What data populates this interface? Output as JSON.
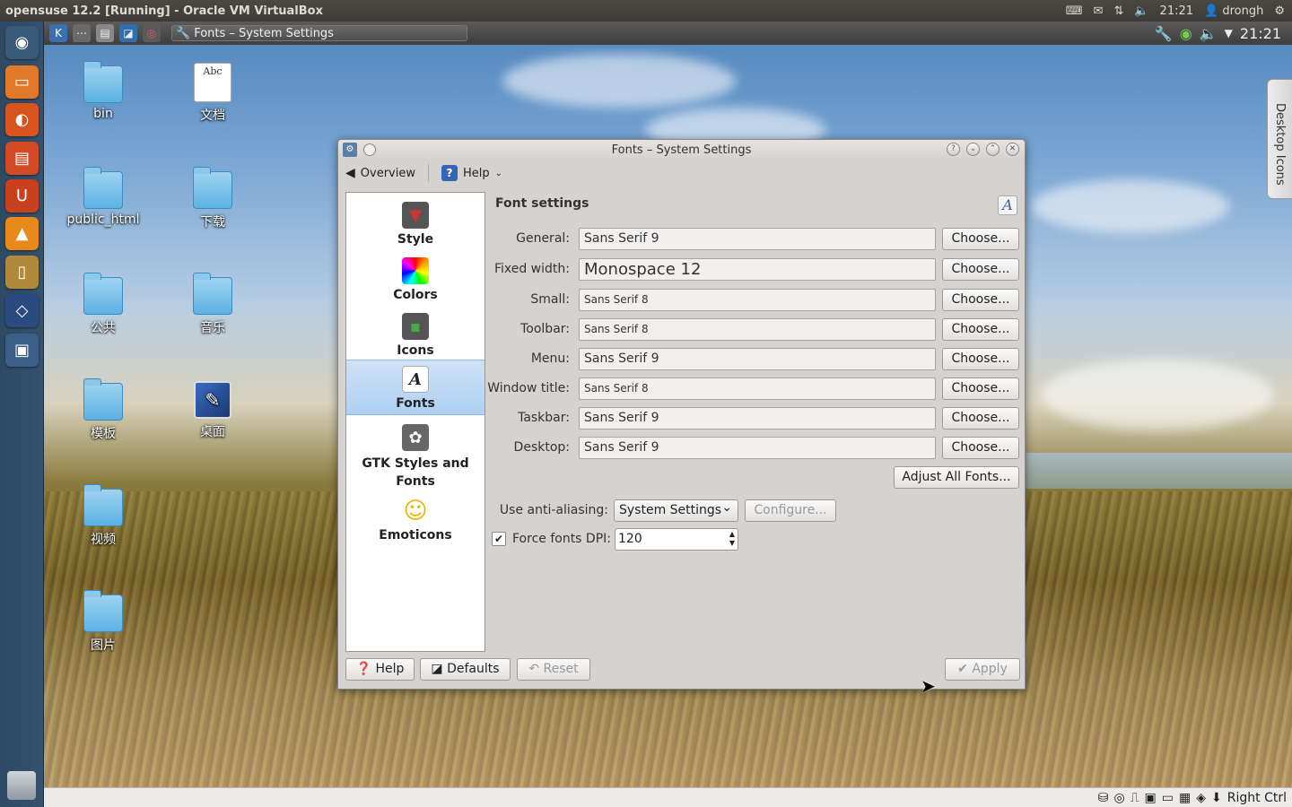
{
  "topbar": {
    "title": "opensuse 12.2 [Running] - Oracle VM VirtualBox",
    "time": "21:21",
    "user": "drongh"
  },
  "kde_panel": {
    "task_title": "Fonts – System Settings",
    "time": "21:21"
  },
  "desktop_icons": {
    "bin": "bin",
    "docs": "文档",
    "docs_icon_text": "Abc",
    "public_html": "public_html",
    "downloads": "下载",
    "public": "公共",
    "music": "音乐",
    "templates": "模板",
    "desktop": "桌面",
    "videos": "视频",
    "pictures": "图片"
  },
  "desktop_tab": "Desktop Icons",
  "window": {
    "title": "Fonts – System Settings",
    "toolbar": {
      "overview": "Overview",
      "help": "Help"
    },
    "categories": [
      {
        "label": "Style"
      },
      {
        "label": "Colors"
      },
      {
        "label": "Icons"
      },
      {
        "label": "Fonts"
      },
      {
        "label": "GTK Styles and Fonts"
      },
      {
        "label": "Emoticons"
      }
    ],
    "section_title": "Font settings",
    "fonts": [
      {
        "label": "General:",
        "value": "Sans Serif 9"
      },
      {
        "label": "Fixed width:",
        "value": "Monospace 12"
      },
      {
        "label": "Small:",
        "value": "Sans Serif 8"
      },
      {
        "label": "Toolbar:",
        "value": "Sans Serif 8"
      },
      {
        "label": "Menu:",
        "value": "Sans Serif 9"
      },
      {
        "label": "Window title:",
        "value": "Sans Serif 8"
      },
      {
        "label": "Taskbar:",
        "value": "Sans Serif 9"
      },
      {
        "label": "Desktop:",
        "value": "Sans Serif 9"
      }
    ],
    "choose_label": "Choose...",
    "adjust_all": "Adjust All Fonts...",
    "antialias_label": "Use anti-aliasing:",
    "antialias_value": "System Settings",
    "configure": "Configure...",
    "dpi_label": "Force fonts DPI:",
    "dpi_value": "120",
    "dpi_checked": true,
    "buttons": {
      "help": "Help",
      "defaults": "Defaults",
      "reset": "Reset",
      "apply": "Apply"
    }
  },
  "statusbar": {
    "host_key": "Right Ctrl"
  }
}
